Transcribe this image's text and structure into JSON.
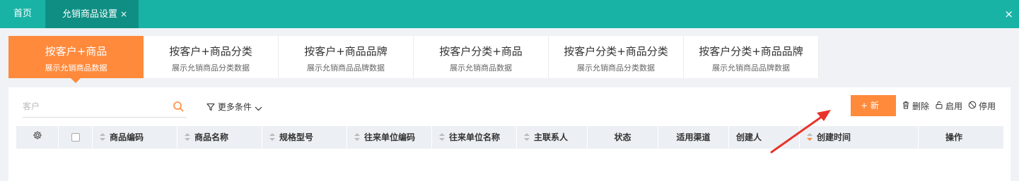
{
  "topbar": {
    "home_label": "首页",
    "active_tab_label": "允销商品设置",
    "active_tab_close": "×",
    "close_all": "×"
  },
  "category_tabs": [
    {
      "title": "按客户+商品",
      "subtitle": "展示允销商品数据"
    },
    {
      "title": "按客户+商品分类",
      "subtitle": "展示允销商品分类数据"
    },
    {
      "title": "按客户+商品品牌",
      "subtitle": "展示允销商品品牌数据"
    },
    {
      "title": "按客户分类+商品",
      "subtitle": "展示允销商品数据"
    },
    {
      "title": "按客户分类+商品分类",
      "subtitle": "展示允销商品分类数据"
    },
    {
      "title": "按客户分类+商品品牌",
      "subtitle": "展示允销商品品牌数据"
    }
  ],
  "search": {
    "placeholder": "客户",
    "value": ""
  },
  "more_conditions": "更多条件",
  "toolbar": {
    "add_label": "+ 新增",
    "delete_label": "删除",
    "enable_label": "启用",
    "disable_label": "停用"
  },
  "table": {
    "columns": [
      "商品编码",
      "商品名称",
      "规格型号",
      "往来单位编码",
      "往来单位名称",
      "主联系人",
      "状态",
      "适用渠道",
      "创建人",
      "创建时间",
      "操作"
    ]
  },
  "colors": {
    "topbar": "#19b3a6",
    "topbar_active": "#0f8f84",
    "accent": "#ff8a3c",
    "annotation_arrow": "#e8332a"
  },
  "icons": [
    "search-icon",
    "filter-icon",
    "chevron-down-icon",
    "trash-icon",
    "lock-icon",
    "ban-icon",
    "gear-icon",
    "close-icon"
  ]
}
